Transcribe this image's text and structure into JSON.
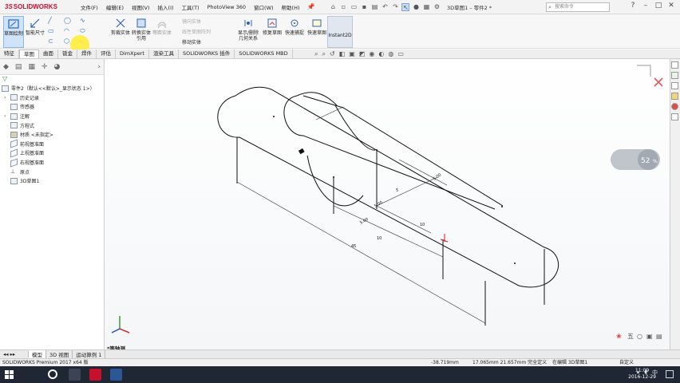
{
  "app": {
    "logo_prefix": "3S",
    "logo_name": "SOLIDWORKS",
    "menus": [
      "文件(F)",
      "编辑(E)",
      "视图(V)",
      "插入(I)",
      "工具(T)",
      "PhotoView 360",
      "窗口(W)",
      "帮助(H)"
    ],
    "document_title": "3D草图1 – 零件2 *",
    "search_placeholder": "搜索命令",
    "window_buttons": [
      "?",
      "–",
      "□",
      "✕"
    ]
  },
  "ribbon": {
    "big_buttons": [
      {
        "label": "草图绘制",
        "active": true
      },
      {
        "label": "智能尺寸",
        "active": false
      }
    ],
    "mid_buttons": [
      "剪裁实体",
      "转换实体引用",
      "等距实体"
    ],
    "text_tools": [
      "镜向实体",
      "线性草图阵列",
      "移动实体"
    ],
    "right_buttons": [
      "显示/删除几何关系",
      "修复草图",
      "快速捕捉",
      "快速草图"
    ],
    "instant2d_label": "Instant2D"
  },
  "tabs": [
    "特征",
    "草图",
    "曲面",
    "钣金",
    "焊件",
    "评估",
    "DimXpert",
    "渲染工具",
    "SOLIDWORKS 插件",
    "SOLIDWORKS MBD"
  ],
  "active_tab_index": 1,
  "feature_tree": {
    "root": "零件2（默认<<默认>_显示状态 1>）",
    "items": [
      {
        "label": "历史记录",
        "icon": "history-icon",
        "expandable": true
      },
      {
        "label": "传感器",
        "icon": "sensor-icon",
        "expandable": false
      },
      {
        "label": "注解",
        "icon": "annotation-icon",
        "expandable": true
      },
      {
        "label": "方程式",
        "icon": "equation-icon",
        "expandable": false
      },
      {
        "label": "材质 <未指定>",
        "icon": "material-icon",
        "expandable": false
      },
      {
        "label": "前视基准面",
        "icon": "plane-icon",
        "expandable": false
      },
      {
        "label": "上视基准面",
        "icon": "plane-icon",
        "expandable": false
      },
      {
        "label": "右视基准面",
        "icon": "plane-icon",
        "expandable": false
      },
      {
        "label": "原点",
        "icon": "origin-icon",
        "expandable": false
      },
      {
        "label": "3D草图1",
        "icon": "sketch3d-icon",
        "expandable": false
      }
    ]
  },
  "viewport": {
    "view_name": "*等轴测",
    "dimension_labels": [
      "5.00",
      "5.00",
      "5.00",
      "10",
      "10",
      "45",
      "5"
    ],
    "hud_value": "52",
    "hud_unit": "%"
  },
  "bottom_tabs": [
    "模型",
    "3D 视图",
    "运动算例 1"
  ],
  "status": {
    "product": "SOLIDWORKS Premium 2017 x64 版",
    "x": "-38.719mm",
    "y_z_state": "17.065mm 21.657mm 完全定义",
    "editing": "在编辑 3D草图1",
    "units": "自定义"
  },
  "taskbar": {
    "time": "11:09",
    "date": "2016-12-29"
  }
}
